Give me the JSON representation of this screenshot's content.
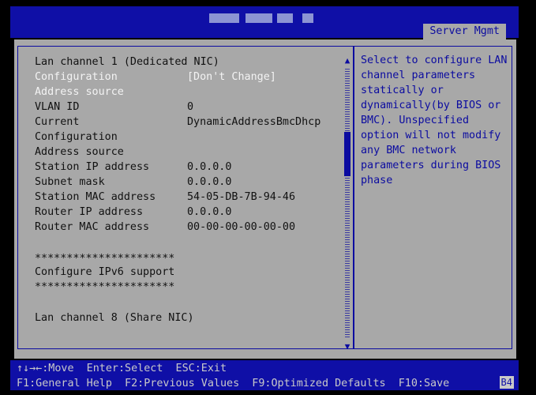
{
  "header": {
    "tab_label": "Server Mgmt"
  },
  "rows": [
    {
      "label": "Lan channel 1 (Dedicated NIC)",
      "value": ""
    },
    {
      "label": "Configuration",
      "value": "[Don't Change]"
    },
    {
      "label": "Address source",
      "value": ""
    },
    {
      "label": "VLAN ID",
      "value": "0"
    },
    {
      "label": "Current",
      "value": "DynamicAddressBmcDhcp"
    },
    {
      "label": "Configuration",
      "value": ""
    },
    {
      "label": "Address source",
      "value": ""
    },
    {
      "label": "Station IP address",
      "value": "0.0.0.0"
    },
    {
      "label": "Subnet mask",
      "value": "0.0.0.0"
    },
    {
      "label": "Station MAC address",
      "value": "54-05-DB-7B-94-46"
    },
    {
      "label": "Router IP address",
      "value": "0.0.0.0"
    },
    {
      "label": "Router MAC address",
      "value": "00-00-00-00-00-00"
    },
    {
      "label": "**********************",
      "value": ""
    },
    {
      "label": "Configure IPv6 support",
      "value": ""
    },
    {
      "label": "**********************",
      "value": ""
    },
    {
      "label": "Lan channel 8 (Share NIC)",
      "value": ""
    }
  ],
  "help_text": "Select to configure LAN\nchannel parameters\nstatically or\ndynamically(by BIOS or\nBMC). Unspecified\noption will not modify\nany BMC network\nparameters during BIOS\nphase",
  "footer": {
    "line1": "↑↓→←:Move  Enter:Select  ESC:Exit",
    "line2": "F1:General Help  F2:Previous Values  F9:Optimized Defaults  F10:Save",
    "version_badge": "B4"
  },
  "scrollbar": {
    "up": "▲",
    "down": "▼"
  },
  "colors": {
    "header_blue": "#0f0fa6",
    "panel_gray": "#a8a8a8",
    "accent_blue": "#0b0ba0"
  }
}
